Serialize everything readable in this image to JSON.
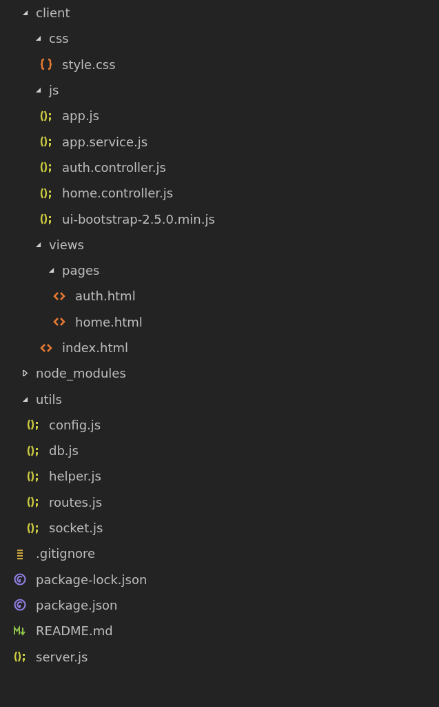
{
  "tree": [
    {
      "kind": "folder",
      "name": "client",
      "expanded": true,
      "children": [
        {
          "kind": "folder",
          "name": "css",
          "expanded": true,
          "children": [
            {
              "kind": "css",
              "name": "style.css"
            }
          ]
        },
        {
          "kind": "folder",
          "name": "js",
          "expanded": true,
          "children": [
            {
              "kind": "js",
              "name": "app.js"
            },
            {
              "kind": "js",
              "name": "app.service.js"
            },
            {
              "kind": "js",
              "name": "auth.controller.js"
            },
            {
              "kind": "js",
              "name": "home.controller.js"
            },
            {
              "kind": "js",
              "name": "ui-bootstrap-2.5.0.min.js"
            }
          ]
        },
        {
          "kind": "folder",
          "name": "views",
          "expanded": true,
          "children": [
            {
              "kind": "folder",
              "name": "pages",
              "expanded": true,
              "children": [
                {
                  "kind": "html",
                  "name": "auth.html"
                },
                {
                  "kind": "html",
                  "name": "home.html"
                }
              ]
            },
            {
              "kind": "html",
              "name": "index.html"
            }
          ]
        }
      ]
    },
    {
      "kind": "folder",
      "name": "node_modules",
      "expanded": false
    },
    {
      "kind": "folder",
      "name": "utils",
      "expanded": true,
      "children": [
        {
          "kind": "js",
          "name": "config.js"
        },
        {
          "kind": "js",
          "name": "db.js"
        },
        {
          "kind": "js",
          "name": "helper.js"
        },
        {
          "kind": "js",
          "name": "routes.js"
        },
        {
          "kind": "js",
          "name": "socket.js"
        }
      ]
    },
    {
      "kind": "text",
      "name": ".gitignore"
    },
    {
      "kind": "npm",
      "name": "package-lock.json"
    },
    {
      "kind": "npm",
      "name": "package.json"
    },
    {
      "kind": "markdown",
      "name": "README.md"
    },
    {
      "kind": "js",
      "name": "server.js"
    }
  ]
}
